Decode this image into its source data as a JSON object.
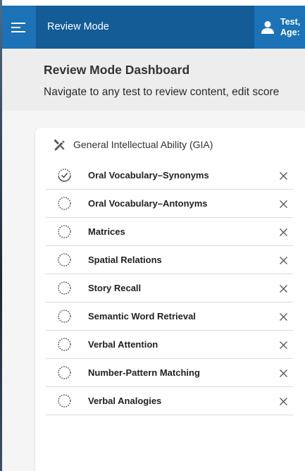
{
  "header": {
    "app_title": "Review Mode",
    "user_line1": "Test,",
    "user_line2": "Age:",
    "menu_icon": "hamburger-menu-icon",
    "user_icon": "user-icon"
  },
  "dashboard": {
    "title": "Review Mode Dashboard",
    "subtitle": "Navigate to any test to review content, edit score"
  },
  "card": {
    "title": "General Intellectual Ability (GIA)",
    "title_icon": "edit-pencil-ruler-icon",
    "tests": [
      {
        "name": "Oral Vocabulary–Synonyms",
        "status": "in-progress"
      },
      {
        "name": "Oral Vocabulary–Antonyms",
        "status": "not-started"
      },
      {
        "name": "Matrices",
        "status": "not-started"
      },
      {
        "name": "Spatial Relations",
        "status": "not-started"
      },
      {
        "name": "Story Recall",
        "status": "not-started"
      },
      {
        "name": "Semantic Word Retrieval",
        "status": "not-started"
      },
      {
        "name": "Verbal Attention",
        "status": "not-started"
      },
      {
        "name": "Number-Pattern Matching",
        "status": "not-started"
      },
      {
        "name": "Verbal Analogies",
        "status": "not-started"
      }
    ]
  },
  "colors": {
    "topbar": "#135c96",
    "topbar_accent": "#1b72b6",
    "header_band": "#ededed",
    "content_bg": "#f5f5f5"
  }
}
